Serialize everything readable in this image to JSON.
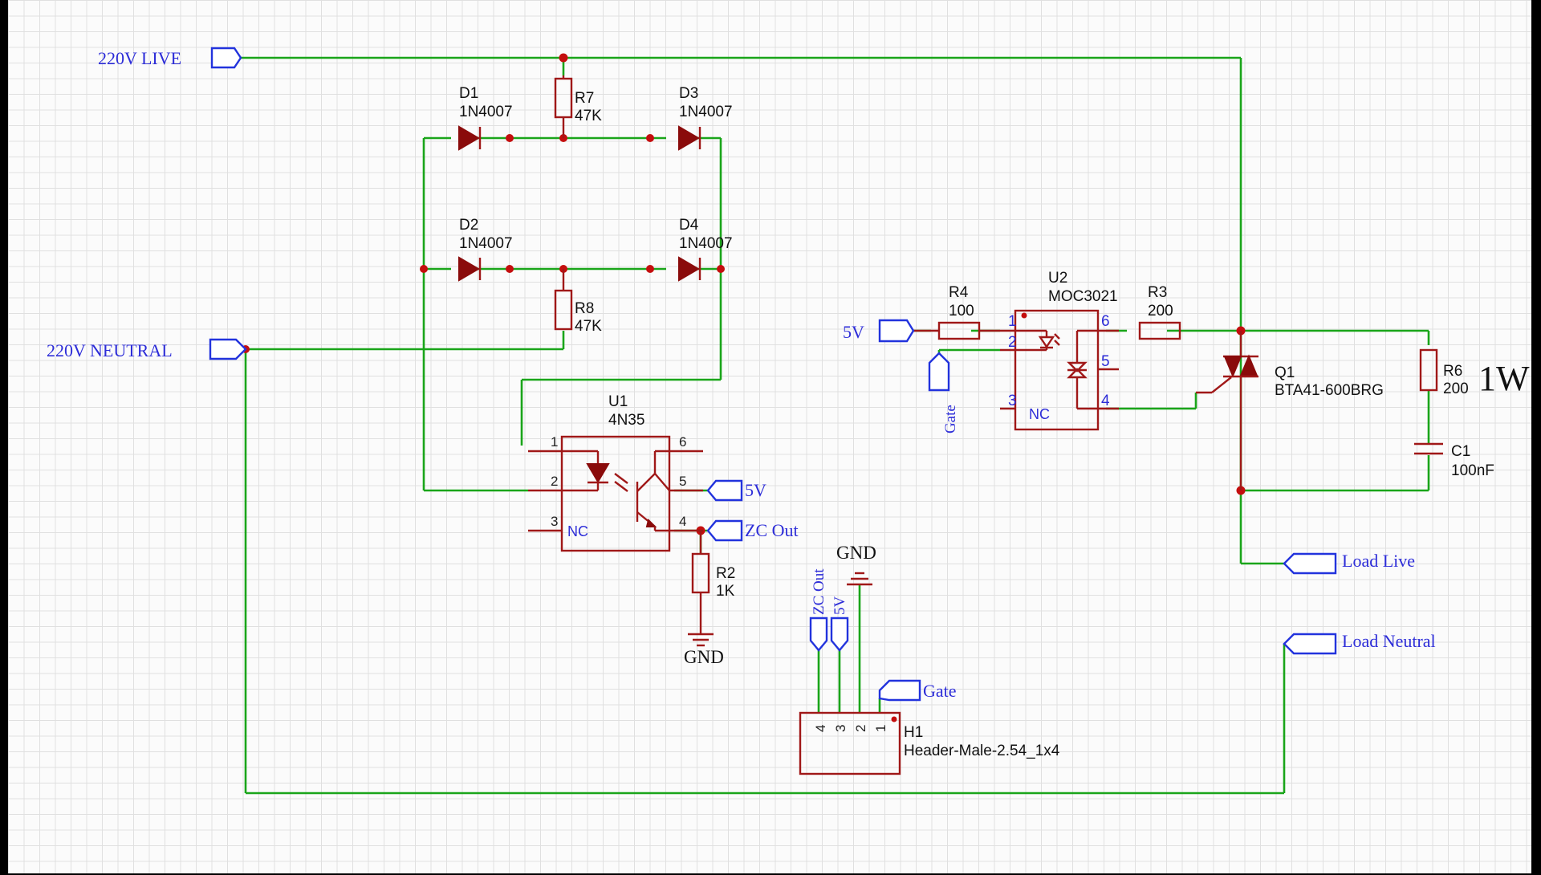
{
  "nets": {
    "live": "220V LIVE",
    "neutral": "220V NEUTRAL",
    "fivev_u2": "5V",
    "fivev_u1": "5V",
    "zc_out": "ZC Out",
    "gate_u2": "Gate",
    "gate_h1": "Gate",
    "load_live": "Load Live",
    "load_neutral": "Load Neutral",
    "gnd_r2": "GND",
    "gnd_h1": "GND",
    "h1_zc": "ZC Out",
    "h1_5v": "5V"
  },
  "components": {
    "d1": {
      "ref": "D1",
      "value": "1N4007"
    },
    "d2": {
      "ref": "D2",
      "value": "1N4007"
    },
    "d3": {
      "ref": "D3",
      "value": "1N4007"
    },
    "d4": {
      "ref": "D4",
      "value": "1N4007"
    },
    "r7": {
      "ref": "R7",
      "value": "47K"
    },
    "r8": {
      "ref": "R8",
      "value": "47K"
    },
    "r4": {
      "ref": "R4",
      "value": "100"
    },
    "r3": {
      "ref": "R3",
      "value": "200"
    },
    "r2": {
      "ref": "R2",
      "value": "1K"
    },
    "r6": {
      "ref": "R6",
      "value": "200"
    },
    "c1": {
      "ref": "C1",
      "value": "100nF"
    },
    "u1": {
      "ref": "U1",
      "value": "4N35"
    },
    "u2": {
      "ref": "U2",
      "value": "MOC3021"
    },
    "q1": {
      "ref": "Q1",
      "value": "BTA41-600BRG"
    },
    "h1": {
      "ref": "H1",
      "value": "Header-Male-2.54_1x4"
    }
  },
  "annotations": {
    "r6_power": "1W"
  },
  "pins": {
    "u1": [
      "1",
      "2",
      "3",
      "4",
      "5",
      "6"
    ],
    "u2": [
      "1",
      "2",
      "3",
      "4",
      "5",
      "6"
    ],
    "h1": [
      "4",
      "3",
      "2",
      "1"
    ],
    "nc": "NC"
  },
  "colors": {
    "wire": "#1aa51a",
    "component": "#a01818",
    "net_flag": "#2233dd",
    "junction": "#c40e0e",
    "background": "#fbfbfb"
  }
}
